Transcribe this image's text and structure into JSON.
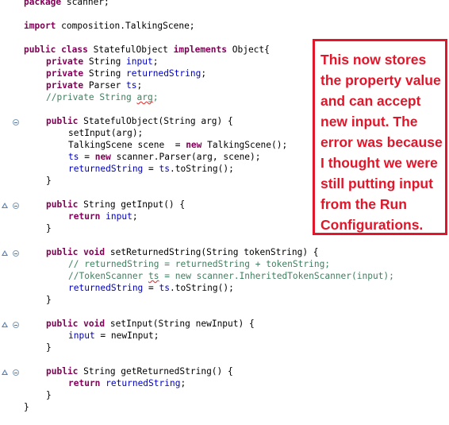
{
  "code": {
    "l1": {
      "kw": "package",
      "rest": " scanner;"
    },
    "l2": {
      "kw": "import",
      "rest": " composition.TalkingScene;"
    },
    "l3": {
      "kw1": "public",
      "kw2": "class",
      "name": " StatefulObject ",
      "kw3": "implements",
      "rest": " Object{"
    },
    "l4": {
      "kw": "private",
      "type": " String ",
      "field": "input",
      "rest": ";"
    },
    "l5": {
      "kw": "private",
      "type": " String ",
      "field": "returnedString",
      "rest": ";"
    },
    "l6": {
      "kw": "private",
      "type": " Parser ",
      "field": "ts",
      "rest": ";"
    },
    "l7": {
      "pre": "//private String ",
      "sq": "arg",
      "post": ";"
    },
    "l8": {
      "kw": "public",
      "rest": " StatefulObject(String arg) {"
    },
    "l9": {
      "text": "setInput(arg);"
    },
    "l10": {
      "pre": "TalkingScene scene  = ",
      "kw": "new",
      "rest": " TalkingScene();"
    },
    "l11": {
      "field": "ts",
      "pre": " = ",
      "kw": "new",
      "rest": " scanner.Parser(arg, scene);"
    },
    "l12": {
      "field": "returnedString",
      "pre": " = ",
      "field2": "ts",
      "rest": ".toString();"
    },
    "l13": {
      "text": "}"
    },
    "l14": {
      "kw": "public",
      "rest": " String getInput() {"
    },
    "l15": {
      "kw": "return",
      "field": " input",
      "rest": ";"
    },
    "l16": {
      "text": "}"
    },
    "l17": {
      "kw1": "public",
      "kw2": "void",
      "rest": " setReturnedString(String tokenString) {"
    },
    "l18": {
      "text": "// returnedString = returnedString + tokenString;"
    },
    "l19": {
      "pre": "//TokenScanner ",
      "sq": "ts",
      "post": " = new scanner.InheritedTokenScanner(input);"
    },
    "l20": {
      "field": "returnedString",
      "pre": " = ",
      "field2": "ts",
      "rest": ".toString();"
    },
    "l21": {
      "text": "}"
    },
    "l22": {
      "kw1": "public",
      "kw2": "void",
      "rest": " setInput(String newInput) {"
    },
    "l23": {
      "field": "input",
      "rest": " = newInput;"
    },
    "l24": {
      "text": "}"
    },
    "l25": {
      "kw": "public",
      "rest": " String getReturnedString() {"
    },
    "l26": {
      "kw": "return",
      "field": " returnedString",
      "rest": ";"
    },
    "l27": {
      "text": "}"
    },
    "l28": {
      "text": "}"
    }
  },
  "annotation": {
    "lines": [
      "This now stores",
      "the property value",
      "and can accept",
      "new input. The",
      "error was because",
      "I thought we were",
      "still putting input",
      "from the Run",
      "Configurations."
    ]
  },
  "colors": {
    "keyword": "#7f0055",
    "field": "#0000c0",
    "comment": "#3f7f5f",
    "annotation": "#e0162b"
  }
}
